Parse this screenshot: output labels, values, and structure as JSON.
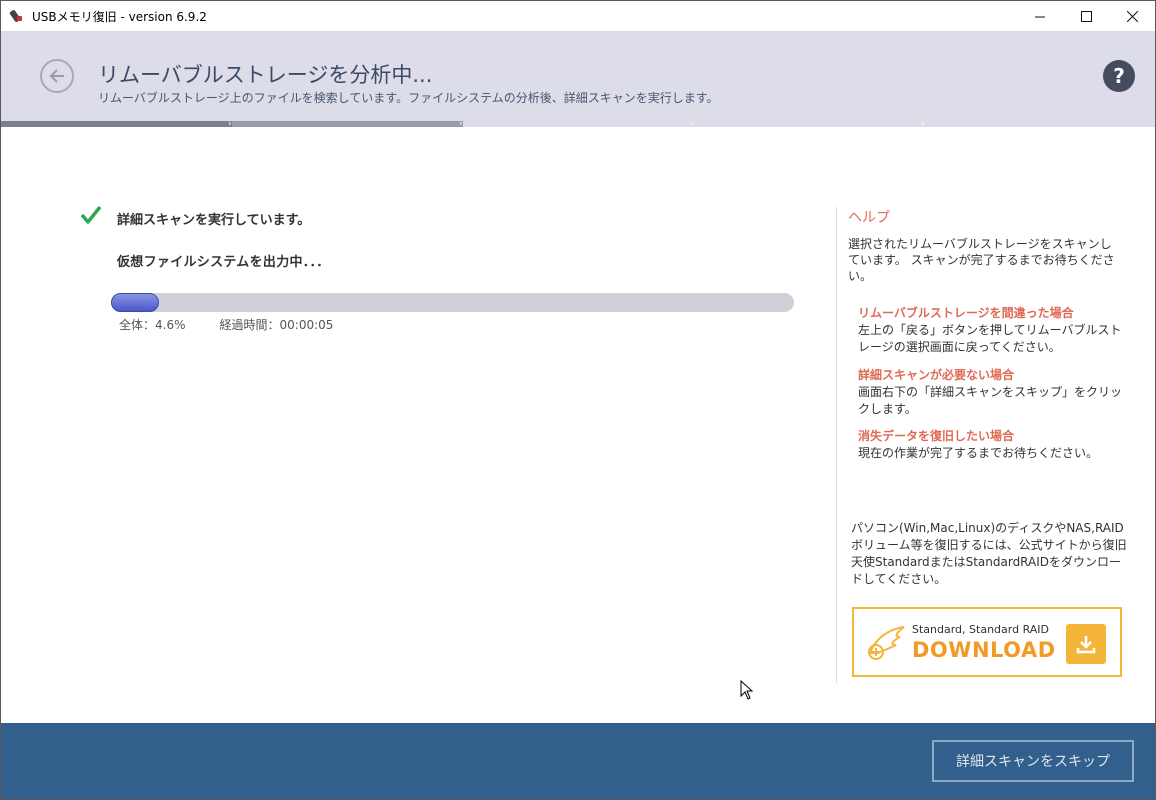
{
  "window": {
    "title": "USBメモリ復旧 - version 6.9.2",
    "minimize": "—",
    "maximize": "☐",
    "close": "✕"
  },
  "header": {
    "title": "リムーバブルストレージを分析中...",
    "subtitle": "リムーバブルストレージ上のファイルを検索しています。ファイルシステムの分析後、詳細スキャンを実行します。",
    "help_label": "?",
    "back_icon": "arrow-left-icon"
  },
  "steps": {
    "count": 5,
    "completed": 1,
    "active": 2
  },
  "main": {
    "status_done": "詳細スキャンを実行しています。",
    "status_current": "仮想ファイルシステムを出力中．．．",
    "progress": {
      "percent": 4.6,
      "overall_label": "全体：4.6%",
      "elapsed_label": "経過時間：00:00:05"
    }
  },
  "help": {
    "title": "ヘルプ",
    "intro": "選択されたリムーバブルストレージをスキャンしています。 スキャンが完了するまでお待ちください。",
    "items": [
      {
        "title": "リムーバブルストレージを間違った場合",
        "body": "左上の「戻る」ボタンを押してリムーバブルストレージの選択画面に戻ってください。"
      },
      {
        "title": "詳細スキャンが必要ない場合",
        "body": "画面右下の「詳細スキャンをスキップ」をクリックします。"
      },
      {
        "title": "消失データを復旧したい場合",
        "body": "現在の作業が完了するまでお待ちください。"
      }
    ],
    "promo": "パソコン(Win,Mac,Linux)のディスクやNAS,RAIDボリューム等を復旧するには、公式サイトから復旧天使StandardまたはStandardRAIDをダウンロードしてください。",
    "download": {
      "subtitle": "Standard, Standard RAID",
      "label": "DOWNLOAD"
    }
  },
  "footer": {
    "skip_label": "詳細スキャンをスキップ"
  },
  "colors": {
    "accent": "#e06a56",
    "footer": "#325f8c",
    "download": "#f5b53a",
    "check": "#2fa84f"
  }
}
